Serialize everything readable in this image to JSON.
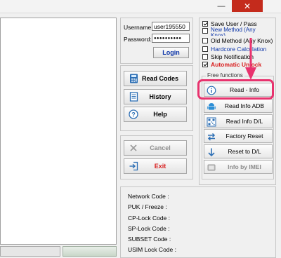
{
  "window": {
    "minimize_glyph": "—",
    "close_glyph": "✕"
  },
  "login": {
    "username_label": "Username:",
    "username_value": "user195550",
    "password_label": "Password:",
    "password_value": "●●●●●●●●●●",
    "login_button": "Login"
  },
  "main_buttons": [
    {
      "label": "Read Codes",
      "icon": "calculator-icon"
    },
    {
      "label": "History",
      "icon": "history-icon"
    },
    {
      "label": "Help",
      "icon": "help-icon"
    }
  ],
  "cancel_button": "Cancel",
  "exit_button": "Exit",
  "options": {
    "save_user_pass": {
      "label": "Save User / Pass",
      "checked": true
    },
    "new_method": {
      "label": "New Method (Any Knox)",
      "checked": false
    },
    "old_method": {
      "label": "Old Method (Any Knox)",
      "checked": false
    },
    "hardcore_calculation": {
      "label": "Hardcore Calculation",
      "checked": false
    },
    "skip_notification": {
      "label": "Skip Notification",
      "checked": false
    },
    "automatic_unlock": {
      "label": "Automatic Unlock",
      "checked": true
    }
  },
  "free_functions": {
    "group_label": "Free functions",
    "buttons": [
      {
        "label": "Read - Info",
        "icon": "info-icon",
        "highlighted": true
      },
      {
        "label": "Read Info ADB",
        "icon": "android-icon"
      },
      {
        "label": "Read Info D/L",
        "icon": "qr-icon"
      },
      {
        "label": "Factory Reset",
        "icon": "arrows-swap-icon"
      },
      {
        "label": "Reset to D/L",
        "icon": "arrow-down-icon"
      },
      {
        "label": "Info by IMEI",
        "icon": "phone-icon",
        "disabled": true
      }
    ]
  },
  "device_info": {
    "network_code": "Network Code :",
    "puk_freeze": "PUK / Freeze :",
    "cp_lock_code": "CP-Lock Code :",
    "sp_lock_code": "SP-Lock Code :",
    "subset_code": "SUBSET Code :",
    "usim_lock_code": "USIM Lock Code :"
  },
  "colors": {
    "highlight": "#e8336e",
    "blue_text": "#0b34a8",
    "red_text": "#d81e1e",
    "close_red": "#c42b1c"
  }
}
